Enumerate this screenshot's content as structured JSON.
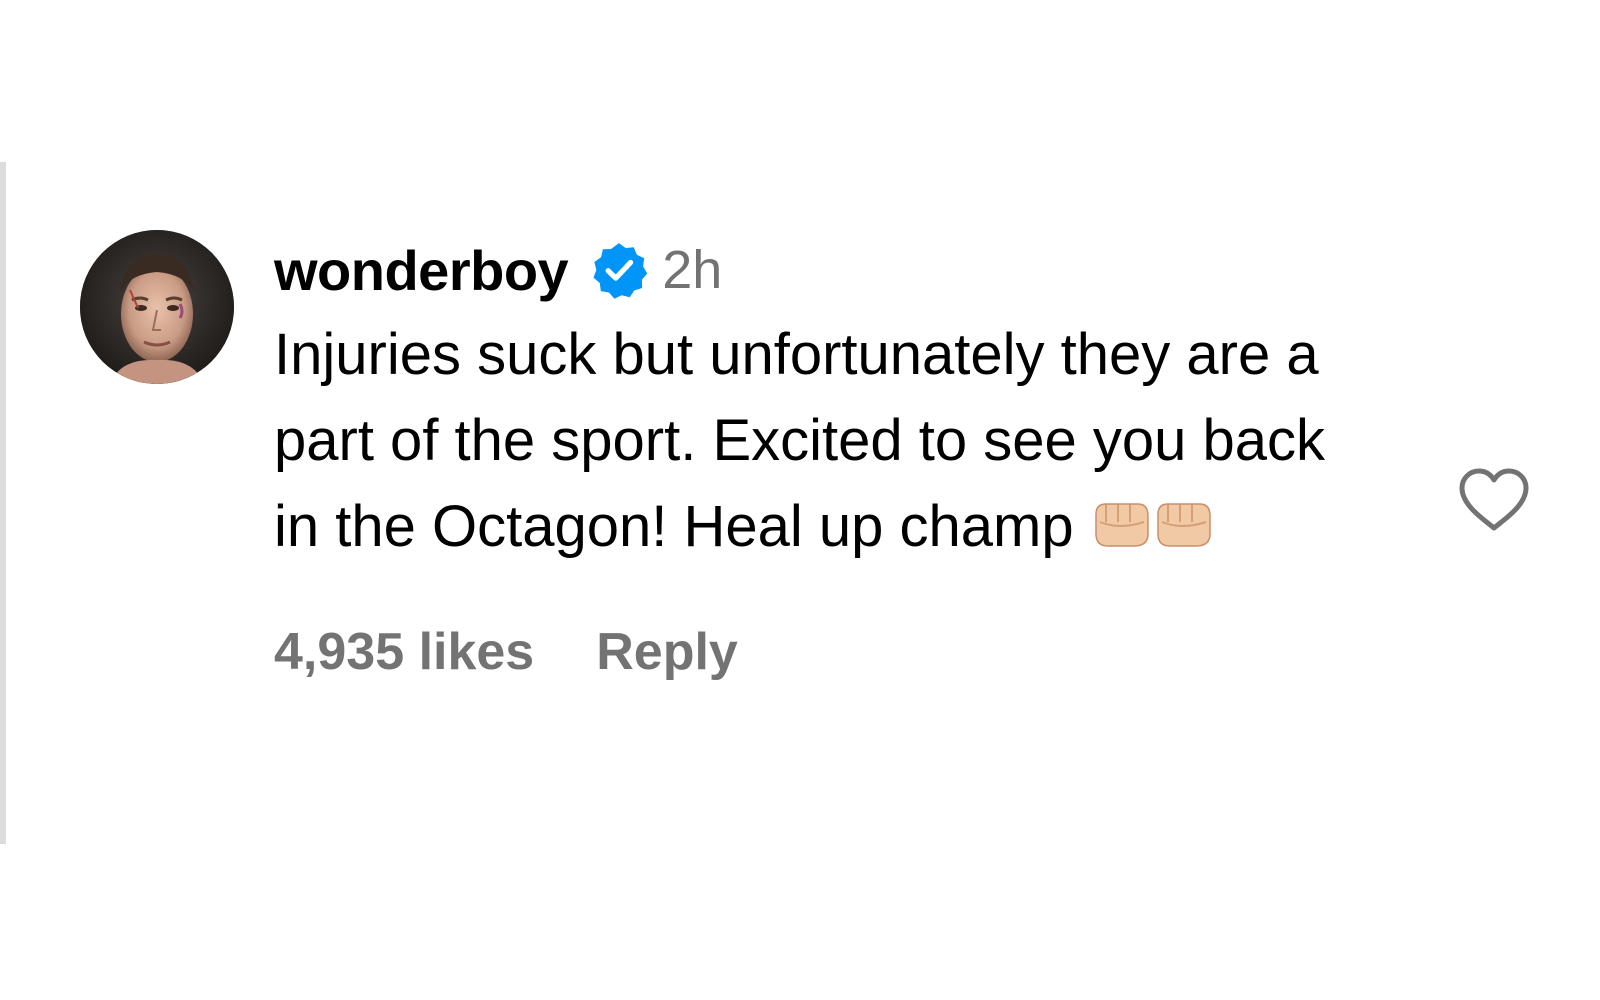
{
  "comment": {
    "username": "wonderboy",
    "verified": true,
    "timestamp": "2h",
    "text": "Injuries suck but unfortunately they are a part of the sport. Excited to see you back in the Octagon! Heal up champ",
    "emojis": [
      "oncoming-fist-light-skin-tone",
      "oncoming-fist-light-skin-tone"
    ],
    "likes": "4,935 likes",
    "reply_label": "Reply",
    "avatar_icon": "profile-photo"
  },
  "colors": {
    "verified_badge": "#0095F6",
    "secondary_text": "#737373",
    "primary_text": "#000000",
    "thread_line": "#DCDCDC"
  }
}
